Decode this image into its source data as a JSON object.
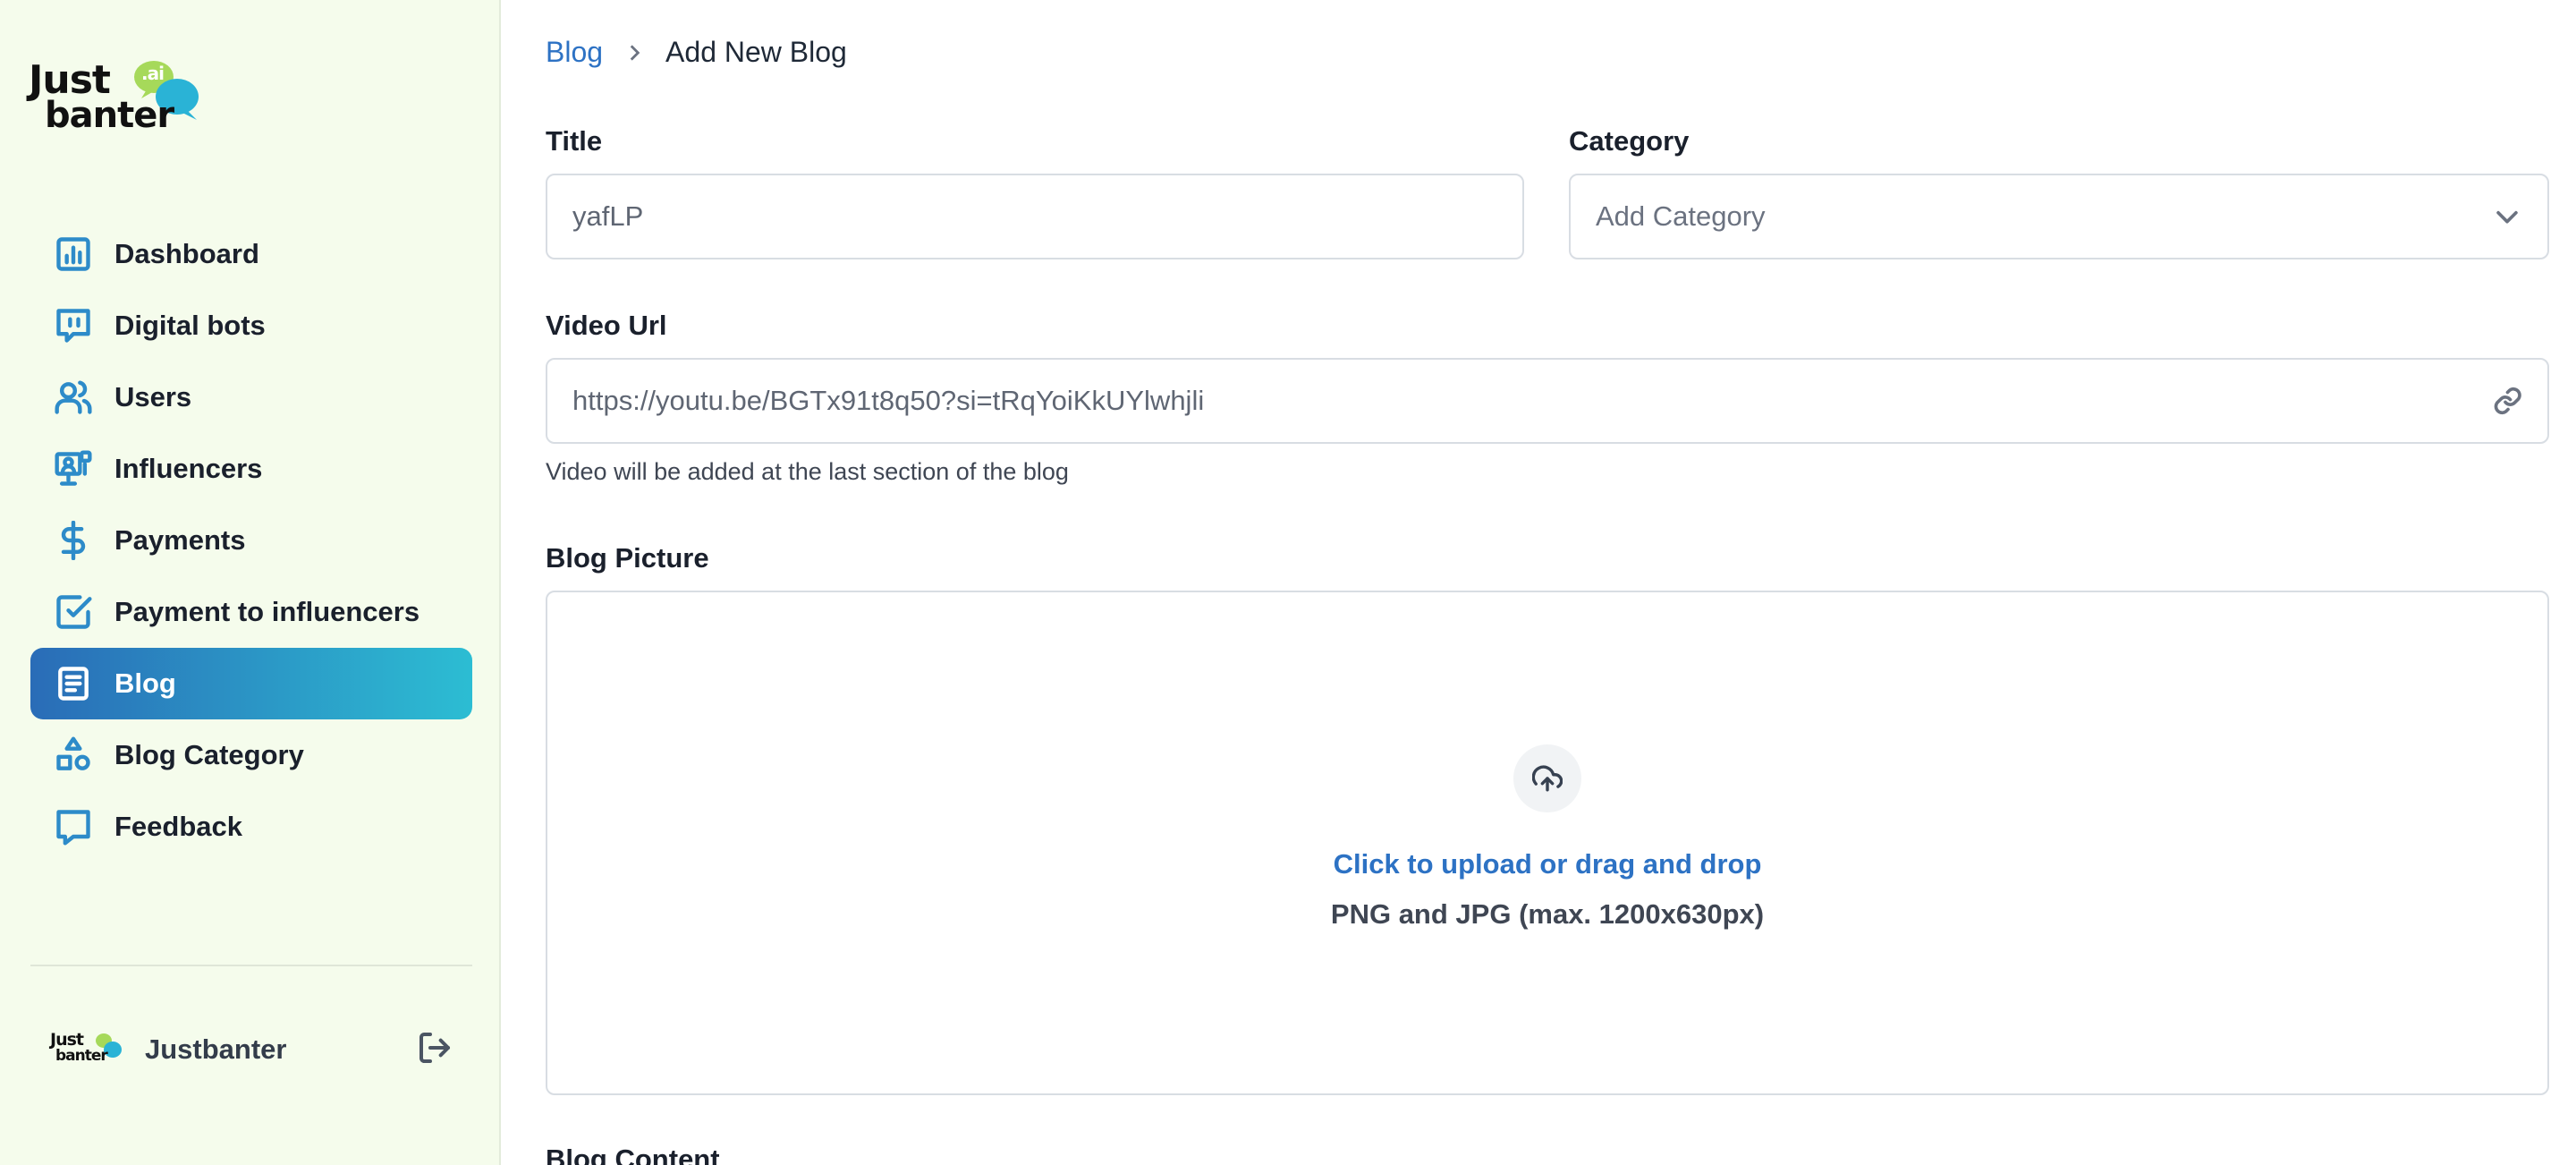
{
  "sidebar": {
    "logo": {
      "line1": "Just",
      "line2": "banter",
      "badge": ".ai"
    },
    "items": [
      {
        "label": "Dashboard",
        "icon": "bar-chart-icon"
      },
      {
        "label": "Digital bots",
        "icon": "chat-bot-icon"
      },
      {
        "label": "Users",
        "icon": "users-icon"
      },
      {
        "label": "Influencers",
        "icon": "influencer-monitor-icon"
      },
      {
        "label": "Payments",
        "icon": "dollar-icon"
      },
      {
        "label": "Payment to influencers",
        "icon": "check-square-icon"
      },
      {
        "label": "Blog",
        "icon": "document-icon",
        "active": true
      },
      {
        "label": "Blog Category",
        "icon": "shapes-icon"
      },
      {
        "label": "Feedback",
        "icon": "message-square-icon"
      }
    ],
    "account": {
      "name": "Justbanter",
      "logo_line1": "Just",
      "logo_line2": "banter"
    }
  },
  "breadcrumb": {
    "parent": "Blog",
    "current": "Add New Blog"
  },
  "form": {
    "title_label": "Title",
    "title_value": "yafLP",
    "category_label": "Category",
    "category_placeholder": "Add Category",
    "video_label": "Video Url",
    "video_value": "https://youtu.be/BGTx91t8q50?si=tRqYoiKkUYlwhjli",
    "video_hint": "Video will be added at the last section of the blog",
    "picture_label": "Blog Picture",
    "upload_cta": "Click to upload or drag and drop",
    "upload_sub": "PNG and JPG (max. 1200x630px)",
    "content_label": "Blog Content"
  },
  "colors": {
    "sidebar_bg": "#f5fcec",
    "accent": "#2d72c4",
    "active_gradient_start": "#2a6cb7",
    "active_gradient_end": "#2cbdd3",
    "icon": "#2d8bc9"
  }
}
